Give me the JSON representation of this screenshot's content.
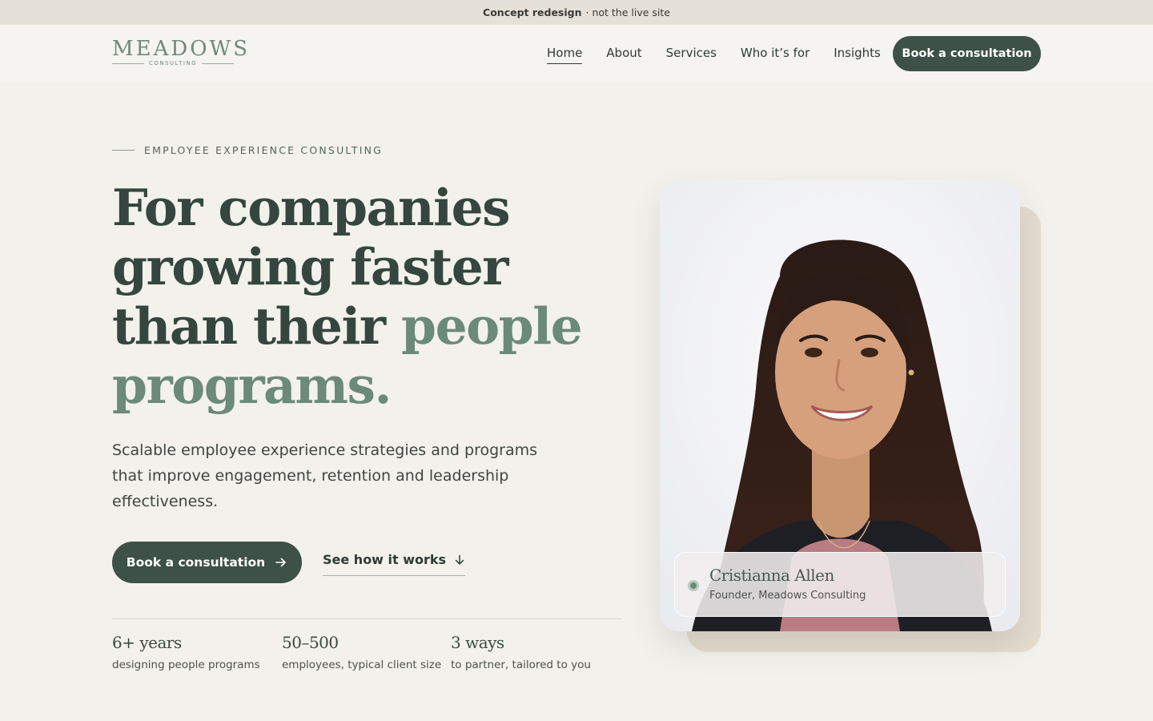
{
  "banner": {
    "strong": "Concept redesign",
    "rest": "· not the live site"
  },
  "logo": {
    "main": "MEADOWS",
    "sub": "CONSULTING"
  },
  "nav": {
    "items": [
      "Home",
      "About",
      "Services",
      "Who it’s for",
      "Insights"
    ],
    "active": "Home",
    "cta": "Book a consultation"
  },
  "hero": {
    "eyebrow": "EMPLOYEE EXPERIENCE CONSULTING",
    "headline_main": "For companies growing faster than their",
    "headline_accent": "people programs.",
    "subhead": "Scalable employee experience strategies and programs that improve engagement, retention and leadership effectiveness.",
    "primary_cta": "Book a consultation",
    "secondary_cta": "See how it works"
  },
  "stats": [
    {
      "value": "6+ years",
      "label": "designing people programs"
    },
    {
      "value": "50–500",
      "label": "employees, typical client size"
    },
    {
      "value": "3 ways",
      "label": "to partner, tailored to you"
    }
  ],
  "profile": {
    "name": "Cristianna Allen",
    "role": "Founder, Meadows Consulting"
  },
  "colors": {
    "brand_dark": "#3d5147",
    "accent": "#6b8a77",
    "background": "#f3f1ec",
    "banner": "#e6e1d8"
  }
}
